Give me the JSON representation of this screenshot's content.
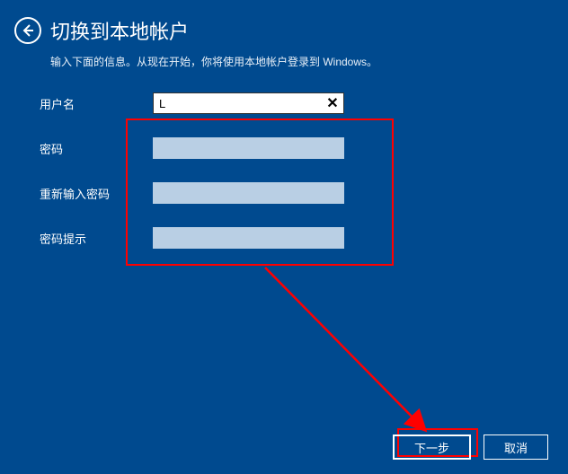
{
  "header": {
    "title": "切换到本地帐户",
    "subtitle": "输入下面的信息。从现在开始，你将使用本地帐户登录到 Windows。"
  },
  "form": {
    "username": {
      "label": "用户名",
      "value": "L"
    },
    "password": {
      "label": "密码",
      "value": ""
    },
    "confirm": {
      "label": "重新输入密码",
      "value": ""
    },
    "hint": {
      "label": "密码提示",
      "value": ""
    }
  },
  "buttons": {
    "next": "下一步",
    "cancel": "取消"
  },
  "icons": {
    "back": "back-arrow",
    "clear": "✕"
  }
}
